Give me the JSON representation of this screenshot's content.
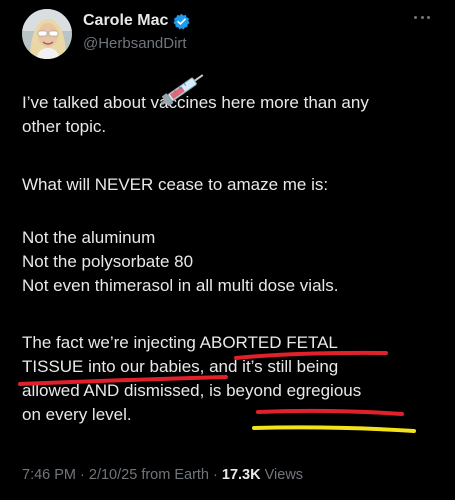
{
  "author": {
    "display_name": "Carole Mac",
    "handle": "@HerbsandDirt",
    "avatar_icon": "avatar-photo",
    "verified_icon": "verified-badge-icon",
    "verified_color": "#1d9bf0"
  },
  "more_icon": "more-options-icon",
  "tweet": {
    "paragraphs": [
      "I’ve talked about vaccines here more than any\nother topic.",
      "What will NEVER cease to amaze me is:",
      "Not the aluminum\nNot the polysorbate 80\nNot even thimerasol in all multi dose vials.",
      "The fact we’re injecting ABORTED FETAL\nTISSUE into our babies, and it’s still being\nallowed AND dismissed, is beyond egregious\non every level."
    ],
    "inline_emoji": "syringe-emoji"
  },
  "meta": {
    "time": "7:46 PM",
    "separator": " · ",
    "date": "2/10/25",
    "source": "from Earth",
    "views_count": "17.3K",
    "views_label": " Views"
  },
  "annotations": {
    "underline_color": "#e0202a",
    "highlight_color": "#f2e21a"
  }
}
